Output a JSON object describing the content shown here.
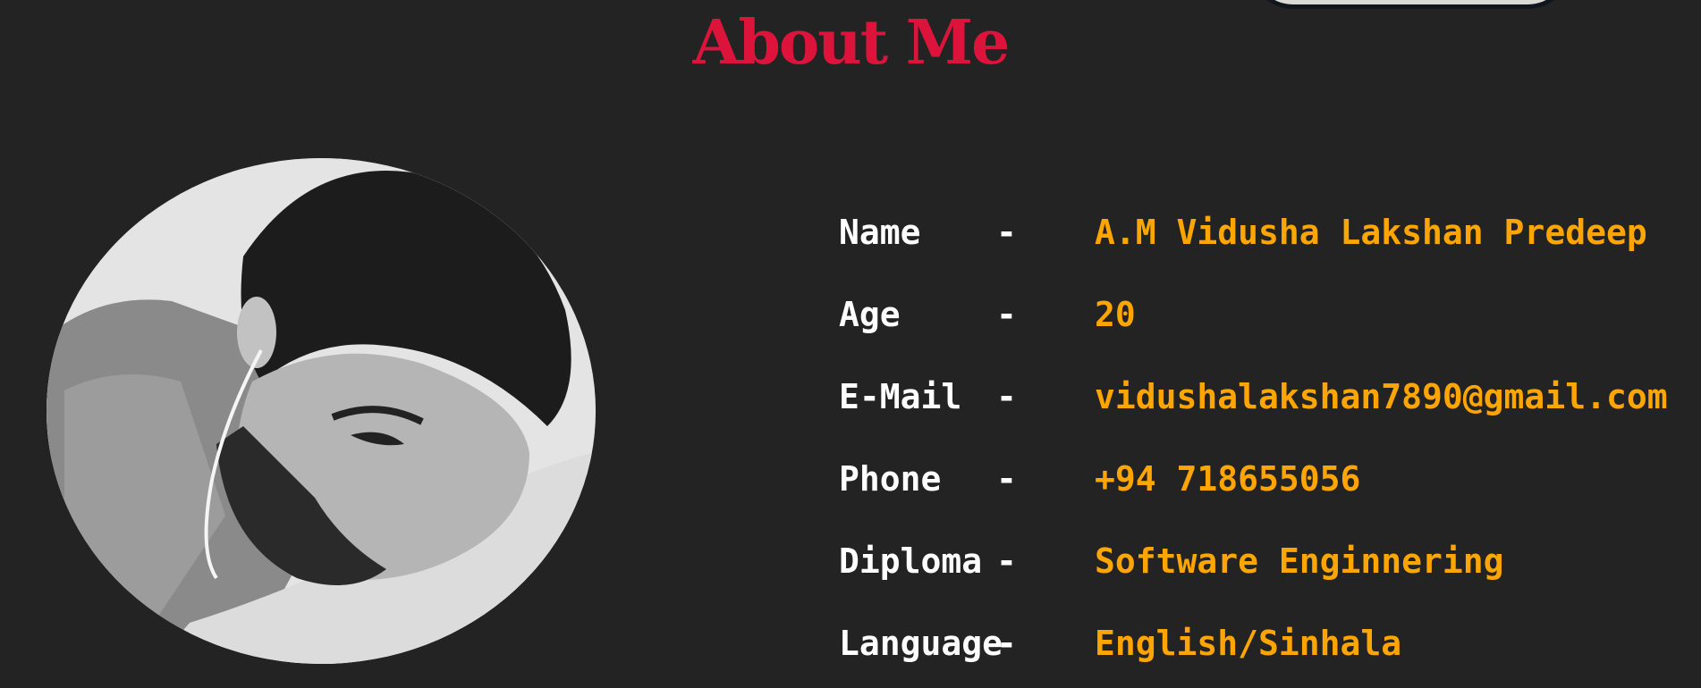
{
  "about": {
    "title": "About Me"
  },
  "details": [
    {
      "label": "Name",
      "separator": "-",
      "value": "A.M Vidusha Lakshan Predeep"
    },
    {
      "label": "Age",
      "separator": "-",
      "value": "20"
    },
    {
      "label": "E-Mail",
      "separator": "-",
      "value": "vidushalakshan7890@gmail.com"
    },
    {
      "label": "Phone",
      "separator": "-",
      "value": "+94 718655056"
    },
    {
      "label": "Diploma",
      "separator": "-",
      "value": "Software Enginnering"
    },
    {
      "label": "Language",
      "separator": "-",
      "value": "English/Sinhala"
    }
  ],
  "colors": {
    "background": "#232323",
    "title": "#dc143c",
    "label": "#ffffff",
    "value": "#ffa500"
  }
}
